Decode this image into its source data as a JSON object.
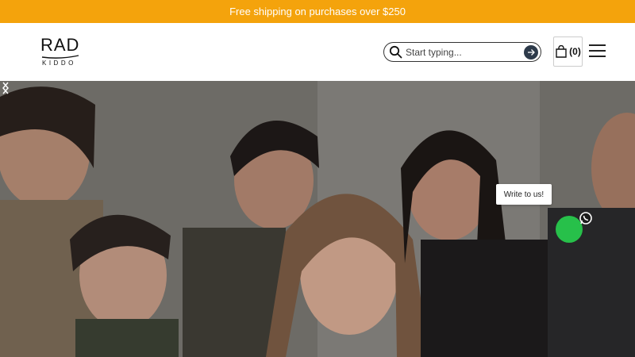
{
  "promo": {
    "text": "Free shipping on purchases over $250"
  },
  "header": {
    "logo": {
      "main": "RAD",
      "sub": "KIDDO"
    },
    "search": {
      "placeholder": "Start typing..."
    },
    "cart": {
      "count_label": "(0)"
    }
  },
  "chat": {
    "bubble_text": "Write to us!"
  },
  "colors": {
    "promo_bg": "#f4a30c",
    "whatsapp_green": "#27c04a",
    "search_submit": "#2d3a4a"
  },
  "icons": {
    "search": "search-icon",
    "submit": "arrow-right-icon",
    "cart": "shopping-bag-icon",
    "menu": "hamburger-icon",
    "prev": "chevron-left-icon",
    "next": "chevron-right-icon",
    "chat": "whatsapp-icon"
  }
}
